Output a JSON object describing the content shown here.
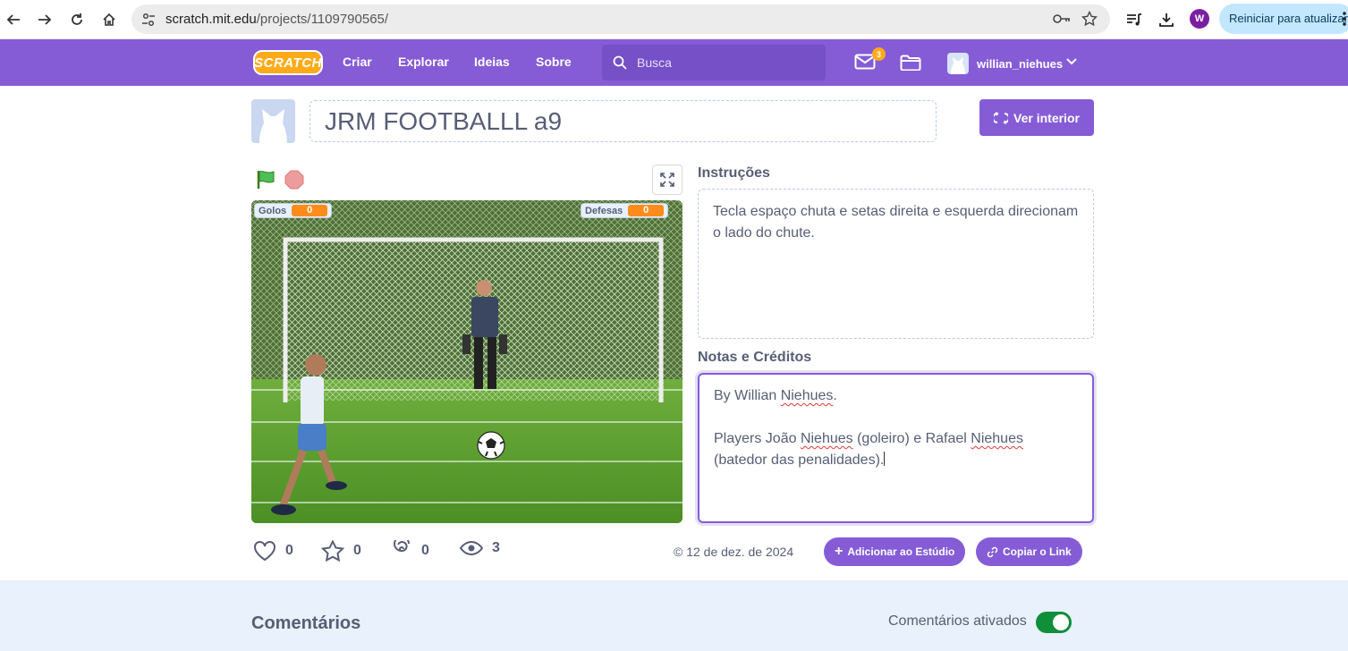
{
  "browser": {
    "url_host": "scratch.mit.edu",
    "url_path": "/projects/1109790565/",
    "profile_initial": "W",
    "update_label": "Reiniciar para atualizar"
  },
  "navbar": {
    "logo": "SCRATCH",
    "links": [
      "Criar",
      "Explorar",
      "Ideias",
      "Sobre"
    ],
    "search_placeholder": "Busca",
    "messages_count": "3",
    "username": "willian_niehues"
  },
  "project": {
    "title": "JRM FOOTBALLL a9",
    "see_inside_label": "Ver interior"
  },
  "stage": {
    "monitors": [
      {
        "label": "Golos",
        "value": "0"
      },
      {
        "label": "Defesas",
        "value": "0"
      }
    ]
  },
  "instructions": {
    "heading": "Instruções",
    "text": "Tecla espaço chuta e setas direita e esquerda direcionam o lado do chute."
  },
  "notes": {
    "heading": "Notas e Créditos",
    "line1_prefix": "By Willian ",
    "line1_name": "Niehues",
    "line1_suffix": ".",
    "line2_a": "Players João ",
    "line2_b": "Niehues",
    "line2_c": " (goleiro) e Rafael ",
    "line2_d": "Niehues",
    "line3": "(batedor das penalidades)."
  },
  "stats": {
    "loves": "0",
    "favorites": "0",
    "remixes": "0",
    "views": "3",
    "date": "12 de dez. de 2024",
    "add_studio_label": "Adicionar ao Estúdio",
    "copy_link_label": "Copiar o Link"
  },
  "comments": {
    "title": "Comentários",
    "toggle_label": "Comentários ativados",
    "enabled": true
  },
  "colors": {
    "scratch_purple": "#855cd6",
    "scratch_orange": "#ffab19",
    "toggle_on": "#0f8f3a"
  }
}
